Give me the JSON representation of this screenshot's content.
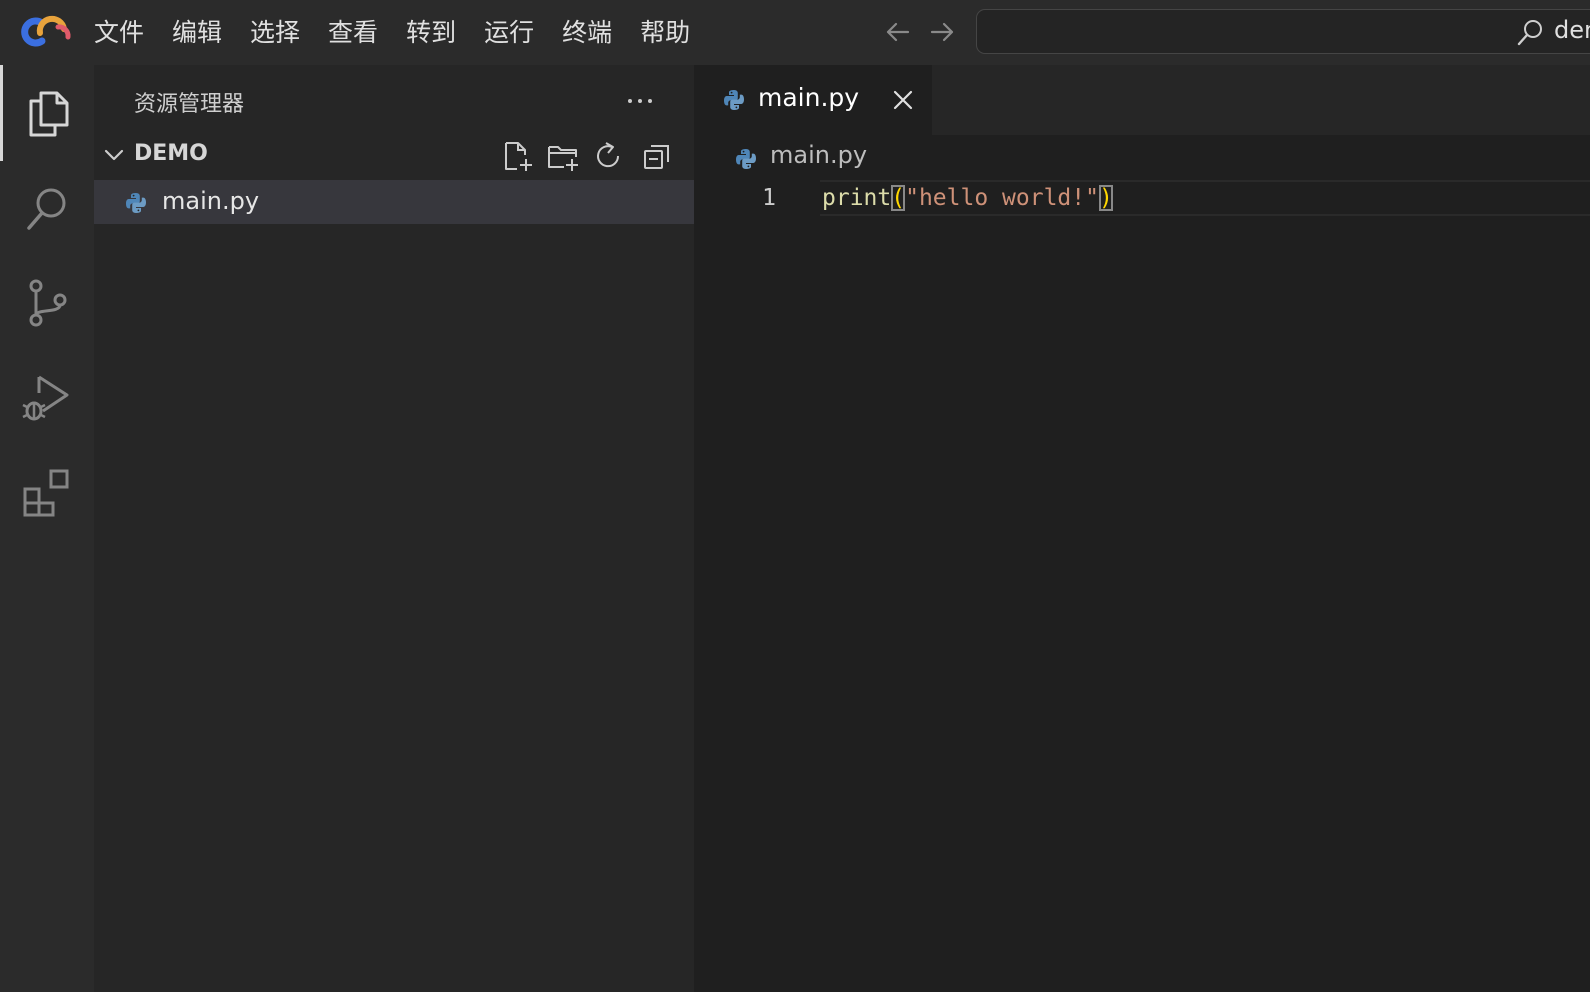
{
  "menu": {
    "items": [
      "文件",
      "编辑",
      "选择",
      "查看",
      "转到",
      "运行",
      "终端",
      "帮助"
    ]
  },
  "command_center": {
    "text": "demo",
    "icon": "search-icon"
  },
  "activity_bar": {
    "items": [
      {
        "id": "explorer",
        "icon": "files-icon",
        "active": true
      },
      {
        "id": "search",
        "icon": "search-icon",
        "active": false
      },
      {
        "id": "source-control",
        "icon": "source-control-icon",
        "active": false
      },
      {
        "id": "run-debug",
        "icon": "run-debug-icon",
        "active": false
      },
      {
        "id": "extensions",
        "icon": "extensions-icon",
        "active": false
      }
    ]
  },
  "sidebar": {
    "title": "资源管理器",
    "folder": {
      "name": "DEMO",
      "actions": [
        "new-file-icon",
        "new-folder-icon",
        "refresh-icon",
        "collapse-all-icon"
      ]
    },
    "files": [
      {
        "name": "main.py",
        "icon": "python-icon",
        "selected": true
      }
    ]
  },
  "editor": {
    "tab": {
      "label": "main.py",
      "icon": "python-icon"
    },
    "breadcrumb": {
      "label": "main.py"
    },
    "lines": [
      {
        "number": "1",
        "tokens": {
          "fn": "print",
          "open": "(",
          "str": "\"hello world!\"",
          "close": ")"
        }
      }
    ]
  },
  "colors": {
    "background": "#1f1f1f",
    "sidebar": "#262626",
    "activity_bar": "#2b2b2b",
    "selection": "#37373d",
    "function": "#dcdcaa",
    "string": "#ce9178",
    "bracket": "#ffd700"
  }
}
